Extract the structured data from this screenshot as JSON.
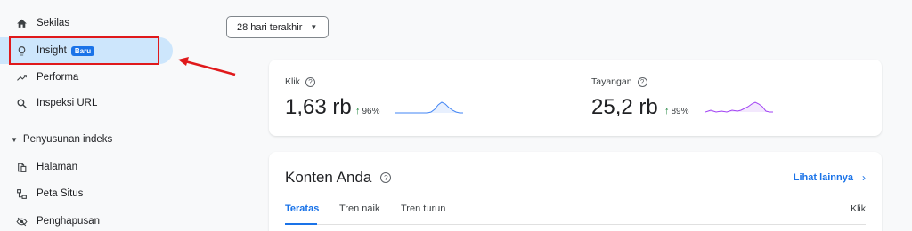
{
  "sidebar": {
    "items": [
      {
        "label": "Sekilas",
        "icon": "home-icon"
      },
      {
        "label": "Insight",
        "icon": "lightbulb-icon",
        "badge": "Baru"
      },
      {
        "label": "Performa",
        "icon": "trending-up-icon"
      },
      {
        "label": "Inspeksi URL",
        "icon": "search-icon"
      }
    ],
    "section_label": "Penyusunan indeks",
    "section_items": [
      {
        "label": "Halaman",
        "icon": "pages-icon"
      },
      {
        "label": "Peta Situs",
        "icon": "sitemap-icon"
      },
      {
        "label": "Penghapusan",
        "icon": "visibility-off-icon"
      }
    ]
  },
  "date_range": {
    "label": "28 hari terakhir"
  },
  "metrics": [
    {
      "label": "Klik",
      "value": "1,63 rb",
      "change": "96%",
      "color": "#4285f4"
    },
    {
      "label": "Tayangan",
      "value": "25,2 rb",
      "change": "89%",
      "color": "#a142f4"
    }
  ],
  "content": {
    "title": "Konten Anda",
    "see_more": "Lihat lainnya",
    "tabs": [
      "Teratas",
      "Tren naik",
      "Tren turun"
    ],
    "column_label": "Klik"
  },
  "colors": {
    "accent": "#1a73e8",
    "annotation": "#e0191b",
    "active_bg": "#cde6fc"
  }
}
